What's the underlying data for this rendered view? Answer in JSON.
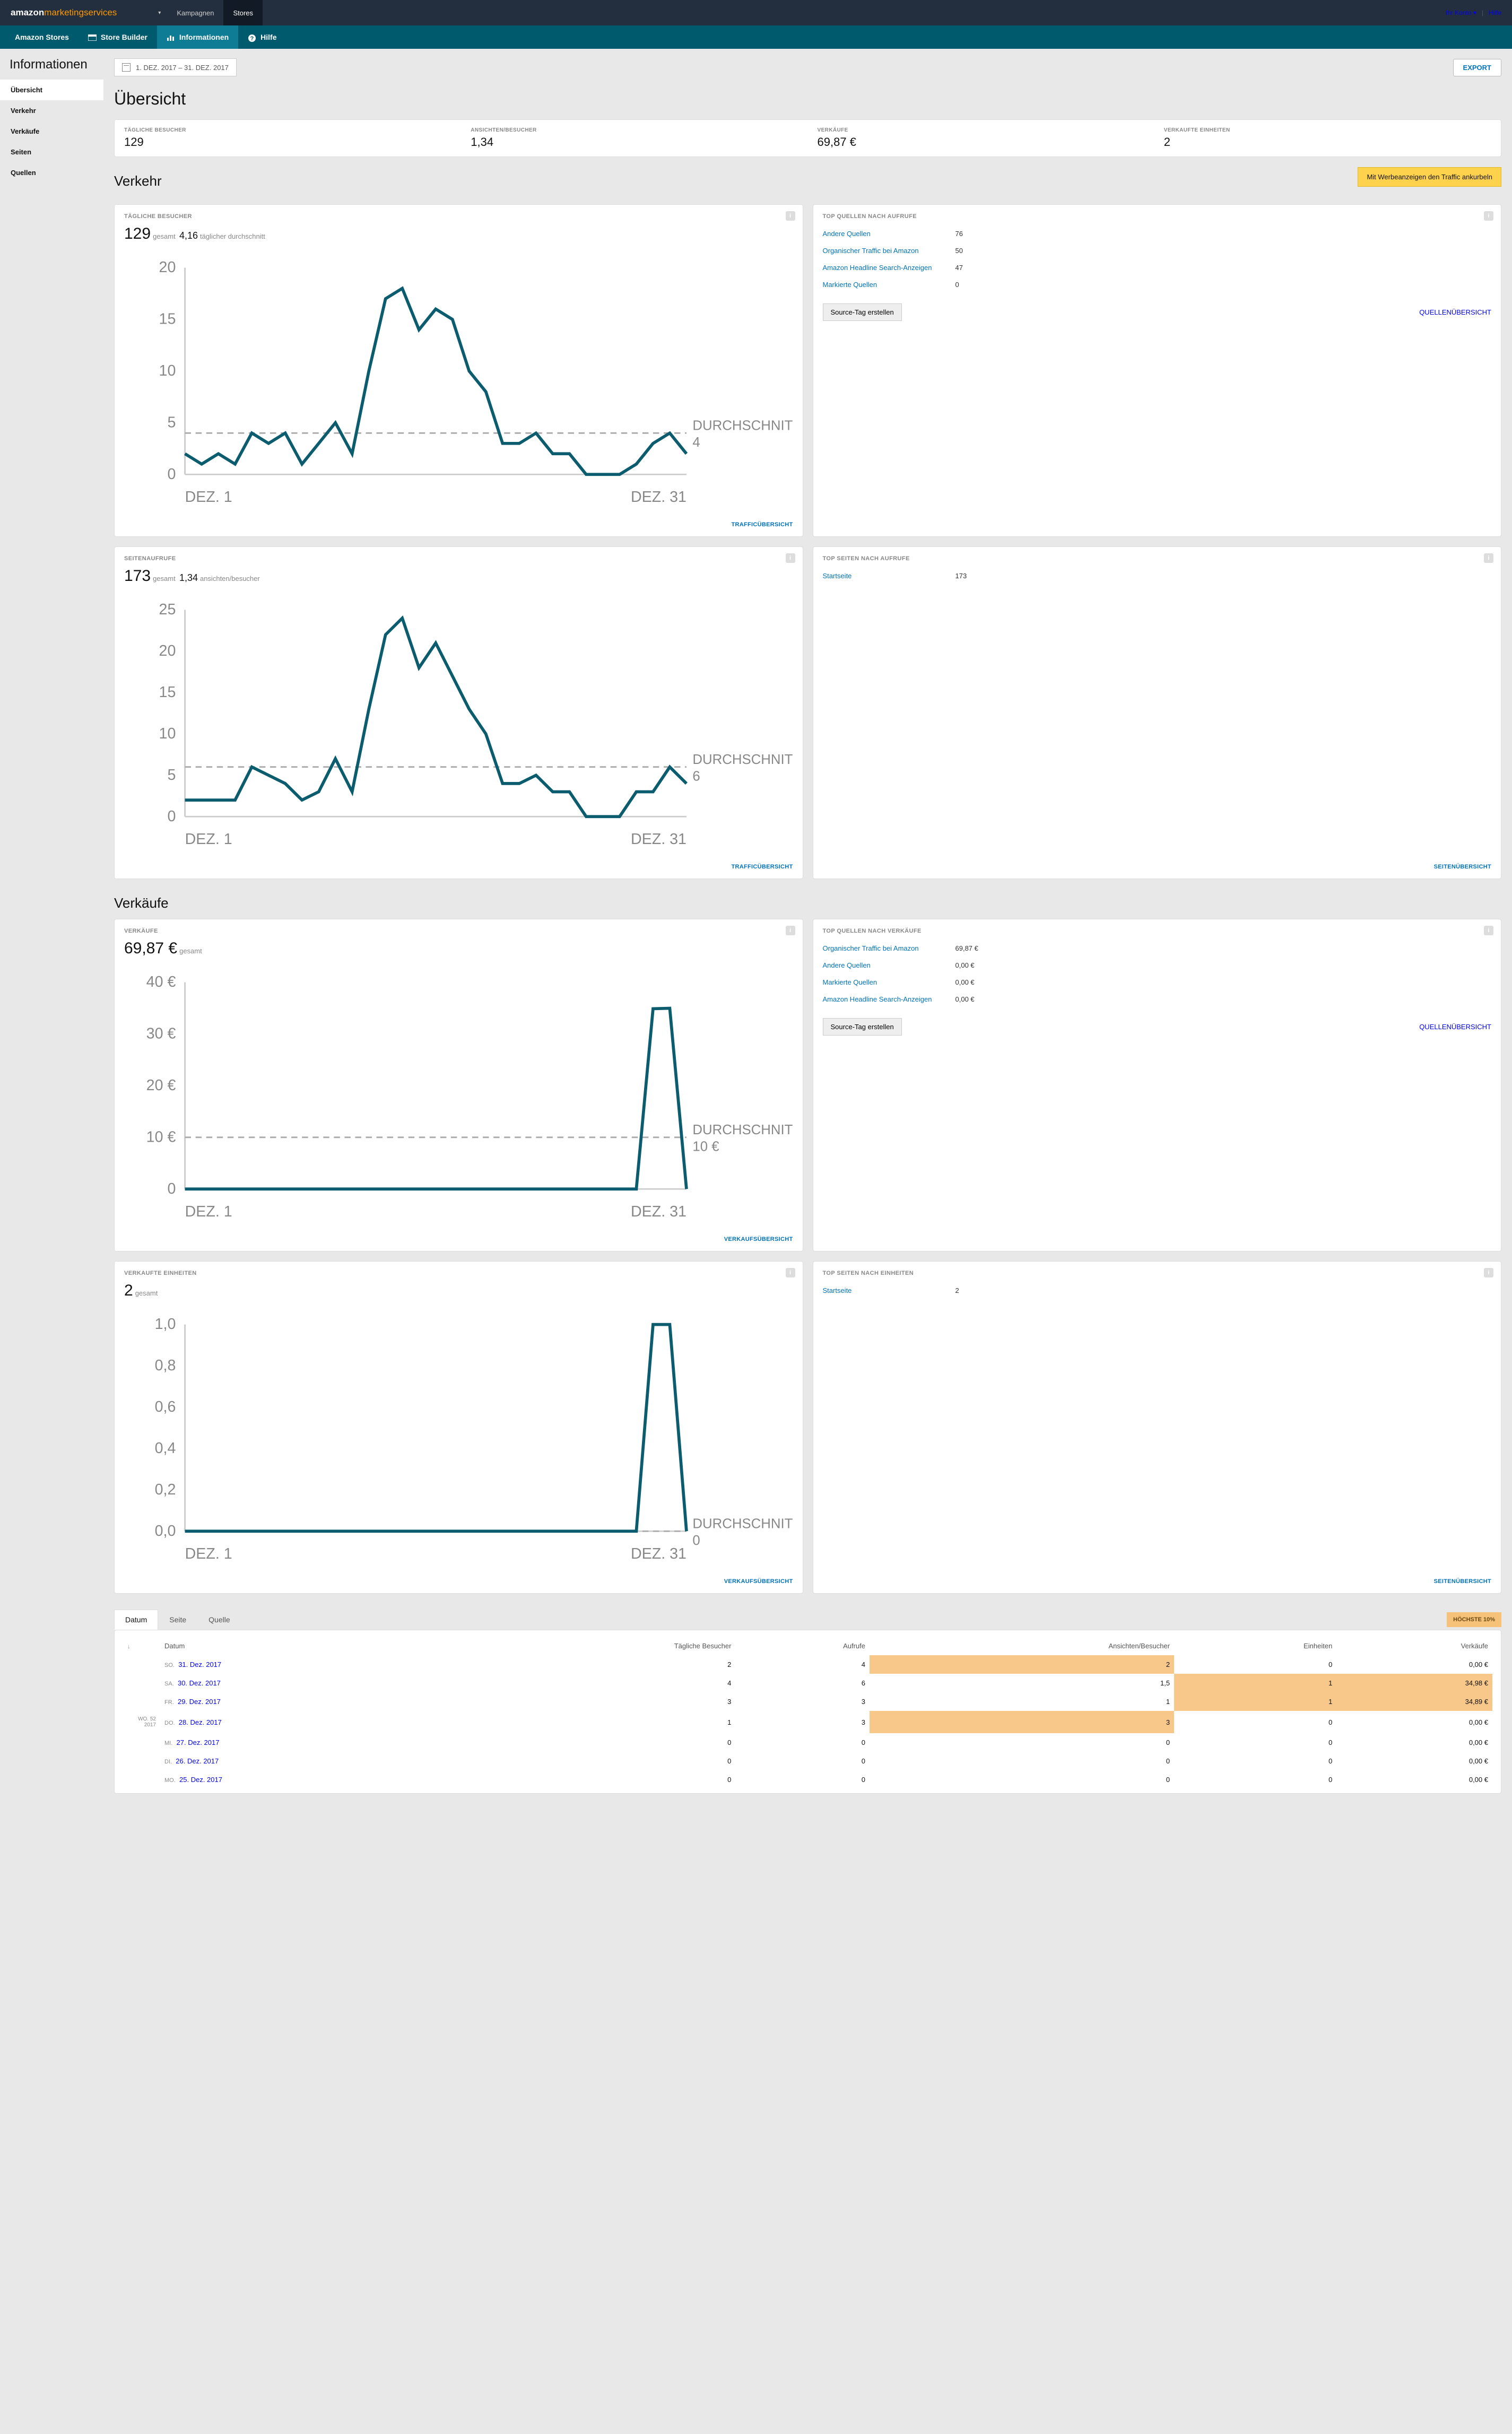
{
  "topbar": {
    "logo1": "amazon",
    "logo2": "marketingservices",
    "nav": {
      "kampagnen": "Kampagnen",
      "stores": "Stores"
    },
    "konto": "Ihr Konto",
    "hilfe": "Hilfe"
  },
  "subnav": {
    "stores": "Amazon Stores",
    "builder": "Store Builder",
    "info": "Informationen",
    "hilfe": "Hilfe"
  },
  "sidebar": {
    "title": "Informationen",
    "items": [
      "Übersicht",
      "Verkehr",
      "Verkäufe",
      "Seiten",
      "Quellen"
    ]
  },
  "header": {
    "daterange": "1. DEZ. 2017 – 31. DEZ. 2017",
    "export": "EXPORT"
  },
  "headings": {
    "uebersicht": "Übersicht",
    "verkehr": "Verkehr",
    "verkaeufe": "Verkäufe",
    "promo": "Mit Werbeanzeigen den Traffic ankurbeln"
  },
  "overview": [
    {
      "label": "TÄGLICHE BESUCHER",
      "value": "129"
    },
    {
      "label": "ANSICHTEN/BESUCHER",
      "value": "1,34"
    },
    {
      "label": "VERKÄUFE",
      "value": "69,87 €"
    },
    {
      "label": "VERKAUFTE EINHEITEN",
      "value": "2"
    }
  ],
  "labels": {
    "gesamt": "gesamt",
    "taeglicher_durchschnitt": "täglicher durchschnitt",
    "ansichten_besucher": "ansichten/besucher",
    "durchschnitt": "DURCHSCHNITT",
    "trafficuebersicht": "TRAFFICÜBERSICHT",
    "quellenuebersicht": "QUELLENÜBERSICHT",
    "seitenuebersicht": "SEITENÜBERSICHT",
    "verkaufsuebersicht": "VERKAUFSÜBERSICHT",
    "source_tag": "Source-Tag erstellen",
    "dez1": "DEZ. 1",
    "dez31": "DEZ. 31",
    "hoechste": "HÖCHSTE 10%"
  },
  "visitorsCard": {
    "head": "TÄGLICHE BESUCHER",
    "total": "129",
    "avg": "4,16",
    "avglabel": "4"
  },
  "pageviewsCard": {
    "head": "SEITENAUFRUFE",
    "total": "173",
    "sub": "1,34",
    "avglabel": "6"
  },
  "salesCard": {
    "head": "VERKÄUFE",
    "total": "69,87 €",
    "avglabel": "10 €"
  },
  "unitsCard": {
    "head": "VERKAUFTE EINHEITEN",
    "total": "2",
    "avglabel": "0"
  },
  "topSourcesViews": {
    "head": "TOP QUELLEN NACH AUFRUFE",
    "rows": [
      {
        "name": "Andere Quellen",
        "val": "76",
        "pct": 100
      },
      {
        "name": "Organischer Traffic bei Amazon",
        "val": "50",
        "pct": 66
      },
      {
        "name": "Amazon Headline Search-Anzeigen",
        "val": "47",
        "pct": 62
      },
      {
        "name": "Markierte Quellen",
        "val": "0",
        "pct": 0
      }
    ]
  },
  "topPagesViews": {
    "head": "TOP SEITEN NACH AUFRUFE",
    "rows": [
      {
        "name": "Startseite",
        "val": "173",
        "pct": 100
      }
    ]
  },
  "topSourcesSales": {
    "head": "TOP QUELLEN NACH VERKÄUFE",
    "rows": [
      {
        "name": "Organischer Traffic bei Amazon",
        "val": "69,87 €",
        "pct": 100
      },
      {
        "name": "Andere Quellen",
        "val": "0,00 €",
        "pct": 0
      },
      {
        "name": "Markierte Quellen",
        "val": "0,00 €",
        "pct": 0
      },
      {
        "name": "Amazon Headline Search-Anzeigen",
        "val": "0,00 €",
        "pct": 0
      }
    ]
  },
  "topPagesUnits": {
    "head": "TOP SEITEN NACH EINHEITEN",
    "rows": [
      {
        "name": "Startseite",
        "val": "2",
        "pct": 100
      }
    ]
  },
  "tableTabs": {
    "datum": "Datum",
    "seite": "Seite",
    "quelle": "Quelle"
  },
  "tableHead": {
    "datum": "Datum",
    "besucher": "Tägliche Besucher",
    "aufrufe": "Aufrufe",
    "ab": "Ansichten/Besucher",
    "einheiten": "Einheiten",
    "verkaeufe": "Verkäufe"
  },
  "tableRows": [
    {
      "wk": "",
      "dow": "SO.",
      "date": "31. Dez. 2017",
      "b": "2",
      "a": "4",
      "ab": "2",
      "abhl": true,
      "e": "0",
      "v": "0,00 €"
    },
    {
      "wk": "",
      "dow": "SA.",
      "date": "30. Dez. 2017",
      "b": "4",
      "a": "6",
      "ab": "1,5",
      "e": "1",
      "ehl": true,
      "v": "34,98 €",
      "vhl": true
    },
    {
      "wk": "",
      "dow": "FR.",
      "date": "29. Dez. 2017",
      "b": "3",
      "a": "3",
      "ab": "1",
      "e": "1",
      "ehl": true,
      "v": "34,89 €",
      "vhl": true
    },
    {
      "wk": "WO. 52 2017",
      "dow": "DO.",
      "date": "28. Dez. 2017",
      "b": "1",
      "a": "3",
      "ab": "3",
      "abhl": true,
      "e": "0",
      "v": "0,00 €"
    },
    {
      "wk": "",
      "dow": "MI.",
      "date": "27. Dez. 2017",
      "b": "0",
      "a": "0",
      "ab": "0",
      "e": "0",
      "v": "0,00 €"
    },
    {
      "wk": "",
      "dow": "DI.",
      "date": "26. Dez. 2017",
      "b": "0",
      "a": "0",
      "ab": "0",
      "e": "0",
      "v": "0,00 €"
    },
    {
      "wk": "",
      "dow": "MO.",
      "date": "25. Dez. 2017",
      "b": "0",
      "a": "0",
      "ab": "0",
      "e": "0",
      "v": "0,00 €"
    }
  ],
  "chart_data": [
    {
      "type": "line",
      "title": "TÄGLICHE BESUCHER",
      "xlabel": "",
      "ylabel": "",
      "x": [
        1,
        2,
        3,
        4,
        5,
        6,
        7,
        8,
        9,
        10,
        11,
        12,
        13,
        14,
        15,
        16,
        17,
        18,
        19,
        20,
        21,
        22,
        23,
        24,
        25,
        26,
        27,
        28,
        29,
        30,
        31
      ],
      "values": [
        2,
        1,
        2,
        1,
        4,
        3,
        4,
        1,
        3,
        5,
        2,
        10,
        17,
        18,
        14,
        16,
        15,
        10,
        8,
        3,
        3,
        4,
        2,
        2,
        0,
        0,
        0,
        1,
        3,
        4,
        2
      ],
      "ylim": [
        0,
        20
      ],
      "average": 4
    },
    {
      "type": "line",
      "title": "SEITENAUFRUFE",
      "x": [
        1,
        2,
        3,
        4,
        5,
        6,
        7,
        8,
        9,
        10,
        11,
        12,
        13,
        14,
        15,
        16,
        17,
        18,
        19,
        20,
        21,
        22,
        23,
        24,
        25,
        26,
        27,
        28,
        29,
        30,
        31
      ],
      "values": [
        2,
        2,
        2,
        2,
        6,
        5,
        4,
        2,
        3,
        7,
        3,
        13,
        22,
        24,
        18,
        21,
        17,
        13,
        10,
        4,
        4,
        5,
        3,
        3,
        0,
        0,
        0,
        3,
        3,
        6,
        4
      ],
      "ylim": [
        0,
        25
      ],
      "average": 6
    },
    {
      "type": "line",
      "title": "VERKÄUFE",
      "x": [
        1,
        2,
        3,
        4,
        5,
        6,
        7,
        8,
        9,
        10,
        11,
        12,
        13,
        14,
        15,
        16,
        17,
        18,
        19,
        20,
        21,
        22,
        23,
        24,
        25,
        26,
        27,
        28,
        29,
        30,
        31
      ],
      "values": [
        0,
        0,
        0,
        0,
        0,
        0,
        0,
        0,
        0,
        0,
        0,
        0,
        0,
        0,
        0,
        0,
        0,
        0,
        0,
        0,
        0,
        0,
        0,
        0,
        0,
        0,
        0,
        0,
        34.89,
        34.98,
        0
      ],
      "ylim": [
        0,
        40
      ],
      "average": 10,
      "yunit": "€"
    },
    {
      "type": "line",
      "title": "VERKAUFTE EINHEITEN",
      "x": [
        1,
        2,
        3,
        4,
        5,
        6,
        7,
        8,
        9,
        10,
        11,
        12,
        13,
        14,
        15,
        16,
        17,
        18,
        19,
        20,
        21,
        22,
        23,
        24,
        25,
        26,
        27,
        28,
        29,
        30,
        31
      ],
      "values": [
        0,
        0,
        0,
        0,
        0,
        0,
        0,
        0,
        0,
        0,
        0,
        0,
        0,
        0,
        0,
        0,
        0,
        0,
        0,
        0,
        0,
        0,
        0,
        0,
        0,
        0,
        0,
        0,
        1,
        1,
        0
      ],
      "ylim": [
        0,
        1
      ],
      "average": 0
    }
  ]
}
